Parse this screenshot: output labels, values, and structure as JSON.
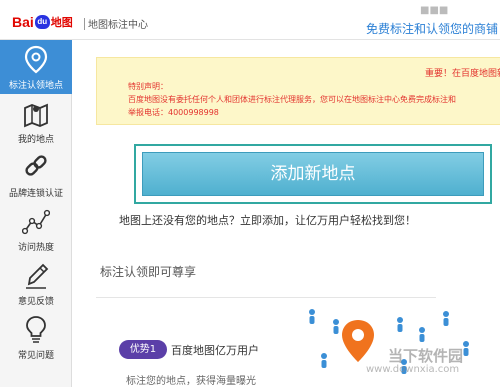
{
  "header": {
    "logo_bai": "Bai",
    "logo_du": "du",
    "logo_ditu": "地图",
    "title": "地图标注中心",
    "right_text": "免费标注和认领您的商铺",
    "ghost_text": "■■■"
  },
  "sidebar": {
    "items": [
      {
        "label": "标注认领地点",
        "icon": "location-pin-icon"
      },
      {
        "label": "我的地点",
        "icon": "map-icon"
      },
      {
        "label": "品牌连锁认证",
        "icon": "chain-link-icon"
      },
      {
        "label": "访问热度",
        "icon": "trend-chart-icon"
      },
      {
        "label": "意见反馈",
        "icon": "pencil-icon"
      },
      {
        "label": "常见问题",
        "icon": "lightbulb-icon"
      }
    ]
  },
  "notice": {
    "head": "重要！在百度地图新",
    "lines": [
      "特别声明：",
      "百度地图没有委托任何个人和团体进行标注代理服务，您可以在地图标注中心免费完成标注和",
      "举报电话：4000998998"
    ]
  },
  "main": {
    "add_button": "添加新地点",
    "tip": "地图上还没有您的地点？立即添加，让亿万用户轻松找到您！",
    "section_title": "标注认领即可尊享",
    "advantage_badge": "优势1",
    "advantage_title": "百度地图亿万用户",
    "advantage_desc": "标注您的地点，获得海量曝光"
  },
  "watermark": {
    "name": "当下软件园",
    "url": "www.downxia.com"
  },
  "colors": {
    "accent_blue": "#3d8ed6",
    "button_teal": "#4fb0cf",
    "notice_red": "#e3342f",
    "badge_purple": "#5b3fa8",
    "pin_orange": "#f0731e"
  }
}
